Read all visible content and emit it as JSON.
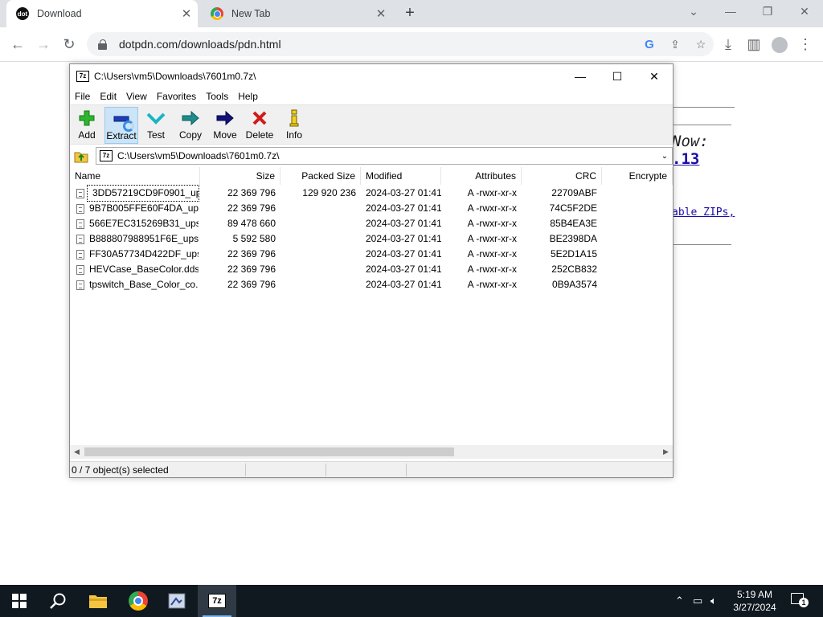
{
  "browser": {
    "tabs": [
      {
        "title": "Download",
        "icon": "dot-favicon",
        "active": true
      },
      {
        "title": "New Tab",
        "icon": "chrome-favicon",
        "active": false
      }
    ],
    "url": "dotpdn.com/downloads/pdn.html",
    "favicon_text": "dot"
  },
  "page": {
    "now_text": "Now:",
    "version_text": ".13",
    "zips_text": "able ZIPs,"
  },
  "sevenzip": {
    "title": "C:\\Users\\vm5\\Downloads\\7601m0.7z\\",
    "logo_text": "7z",
    "menu": [
      "File",
      "Edit",
      "View",
      "Favorites",
      "Tools",
      "Help"
    ],
    "toolbar": [
      {
        "label": "Add",
        "icon": "add-icon"
      },
      {
        "label": "Extract",
        "icon": "extract-icon"
      },
      {
        "label": "Test",
        "icon": "test-icon"
      },
      {
        "label": "Copy",
        "icon": "copy-icon"
      },
      {
        "label": "Move",
        "icon": "move-icon"
      },
      {
        "label": "Delete",
        "icon": "delete-icon"
      },
      {
        "label": "Info",
        "icon": "info-icon"
      }
    ],
    "address": "C:\\Users\\vm5\\Downloads\\7601m0.7z\\",
    "columns": [
      "Name",
      "Size",
      "Packed Size",
      "Modified",
      "Attributes",
      "CRC",
      "Encrypte"
    ],
    "files": [
      {
        "name": "3DD57219CD9F0901_up...",
        "size": "22 369 796",
        "packed": "129 920 236",
        "modified": "2024-03-27 01:41",
        "attributes": "A -rwxr-xr-x",
        "crc": "22709ABF"
      },
      {
        "name": "9B7B005FFE60F4DA_ups...",
        "size": "22 369 796",
        "packed": "",
        "modified": "2024-03-27 01:41",
        "attributes": "A -rwxr-xr-x",
        "crc": "74C5F2DE"
      },
      {
        "name": "566E7EC315269B31_ups...",
        "size": "89 478 660",
        "packed": "",
        "modified": "2024-03-27 01:41",
        "attributes": "A -rwxr-xr-x",
        "crc": "85B4EA3E"
      },
      {
        "name": "B888807988951F6E_upsc...",
        "size": "5 592 580",
        "packed": "",
        "modified": "2024-03-27 01:41",
        "attributes": "A -rwxr-xr-x",
        "crc": "BE2398DA"
      },
      {
        "name": "FF30A57734D422DF_ups...",
        "size": "22 369 796",
        "packed": "",
        "modified": "2024-03-27 01:41",
        "attributes": "A -rwxr-xr-x",
        "crc": "5E2D1A15"
      },
      {
        "name": "HEVCase_BaseColor.dds",
        "size": "22 369 796",
        "packed": "",
        "modified": "2024-03-27 01:41",
        "attributes": "A -rwxr-xr-x",
        "crc": "252CB832"
      },
      {
        "name": "tpswitch_Base_Color_co...",
        "size": "22 369 796",
        "packed": "",
        "modified": "2024-03-27 01:41",
        "attributes": "A -rwxr-xr-x",
        "crc": "0B9A3574"
      }
    ],
    "status": "0 / 7 object(s) selected"
  },
  "taskbar": {
    "time": "5:19 AM",
    "date": "3/27/2024",
    "notification_count": "1",
    "apps": [
      "start-icon",
      "search-icon",
      "file-explorer-icon",
      "chrome-icon",
      "app-icon",
      "7zip-icon"
    ]
  }
}
